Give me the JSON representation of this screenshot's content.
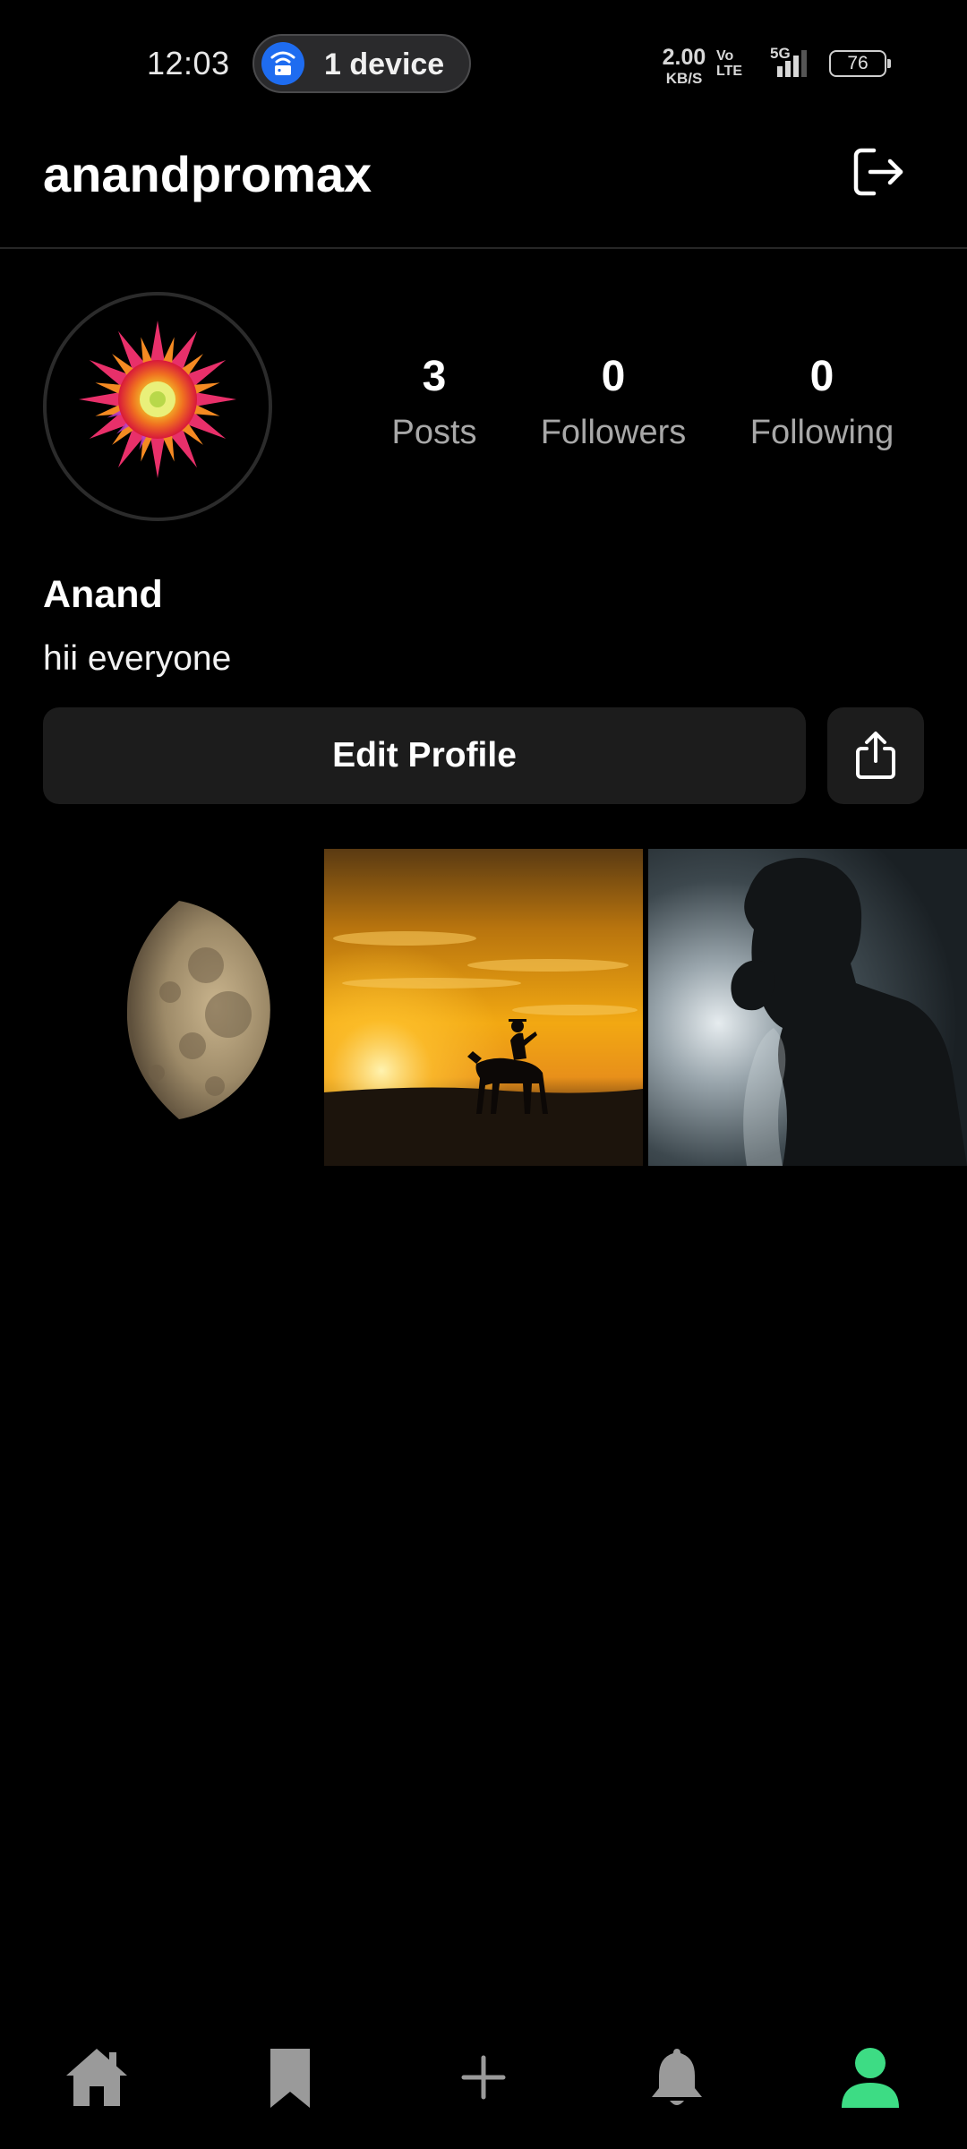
{
  "status_bar": {
    "time": "12:03",
    "hotspot_label": "1 device",
    "net_speed_value": "2.00",
    "net_speed_unit": "KB/S",
    "volte_top": "Vo",
    "volte_bottom": "LTE",
    "network_type": "5G",
    "battery_level": "76"
  },
  "header": {
    "username": "anandpromax",
    "logout_icon": "logout-icon"
  },
  "profile": {
    "display_name": "Anand",
    "bio": "hii everyone",
    "stats": [
      {
        "value": "3",
        "label": "Posts"
      },
      {
        "value": "0",
        "label": "Followers"
      },
      {
        "value": "0",
        "label": "Following"
      }
    ],
    "edit_button_label": "Edit Profile",
    "share_icon": "share-icon"
  },
  "posts": [
    {
      "subject": "moon"
    },
    {
      "subject": "sunset-horse-rider"
    },
    {
      "subject": "silhouette-portrait"
    }
  ],
  "bottom_nav": {
    "items": [
      {
        "icon": "home-icon"
      },
      {
        "icon": "bookmark-icon"
      },
      {
        "icon": "plus-icon"
      },
      {
        "icon": "bell-icon"
      },
      {
        "icon": "profile-icon",
        "active": true
      }
    ],
    "active_color": "#3ddc84",
    "inactive_color": "#9a9a9a"
  }
}
